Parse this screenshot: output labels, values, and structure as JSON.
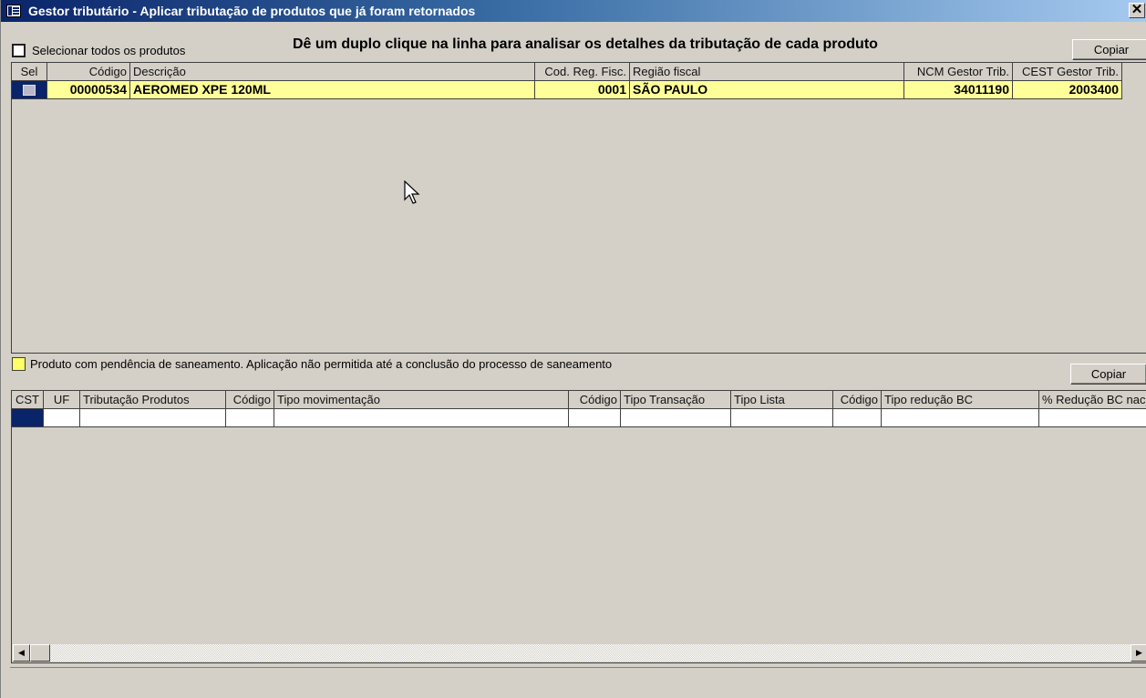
{
  "window": {
    "title": "Gestor tributário - Aplicar tributação de produtos que já foram retornados",
    "close_glyph": "✕"
  },
  "instruction": "Dê um duplo clique na linha para analisar os detalhes da tributação de cada produto",
  "select_all": {
    "label": "Selecionar todos os produtos",
    "checked": false
  },
  "copy_top_label": "Copiar",
  "copy_bottom_label": "Copiar",
  "products": {
    "columns": [
      "Sel",
      "Código",
      "Descrição",
      "Cod. Reg. Fisc.",
      "Região fiscal",
      "NCM Gestor Trib.",
      "CEST Gestor Trib."
    ],
    "rows": [
      {
        "codigo": "00000534",
        "descricao": "AEROMED XPE 120ML",
        "cod_reg_fisc": "0001",
        "regiao_fiscal": "SÃO PAULO",
        "ncm": "34011190",
        "cest": "2003400"
      }
    ]
  },
  "legend": {
    "text": "Produto com pendência de saneamento. Aplicação não permitida até a conclusão do processo de saneamento",
    "color": "#ffff66"
  },
  "taxation": {
    "columns": [
      "CST",
      "UF",
      "Tributação Produtos",
      "Código",
      "Tipo movimentação",
      "Código",
      "Tipo Transação",
      "Tipo Lista",
      "Código",
      "Tipo redução BC",
      "% Redução BC nac"
    ]
  },
  "colors": {
    "row_highlight": "#ffff99",
    "selection": "#0a246a",
    "titlebar": "#0a246a"
  }
}
